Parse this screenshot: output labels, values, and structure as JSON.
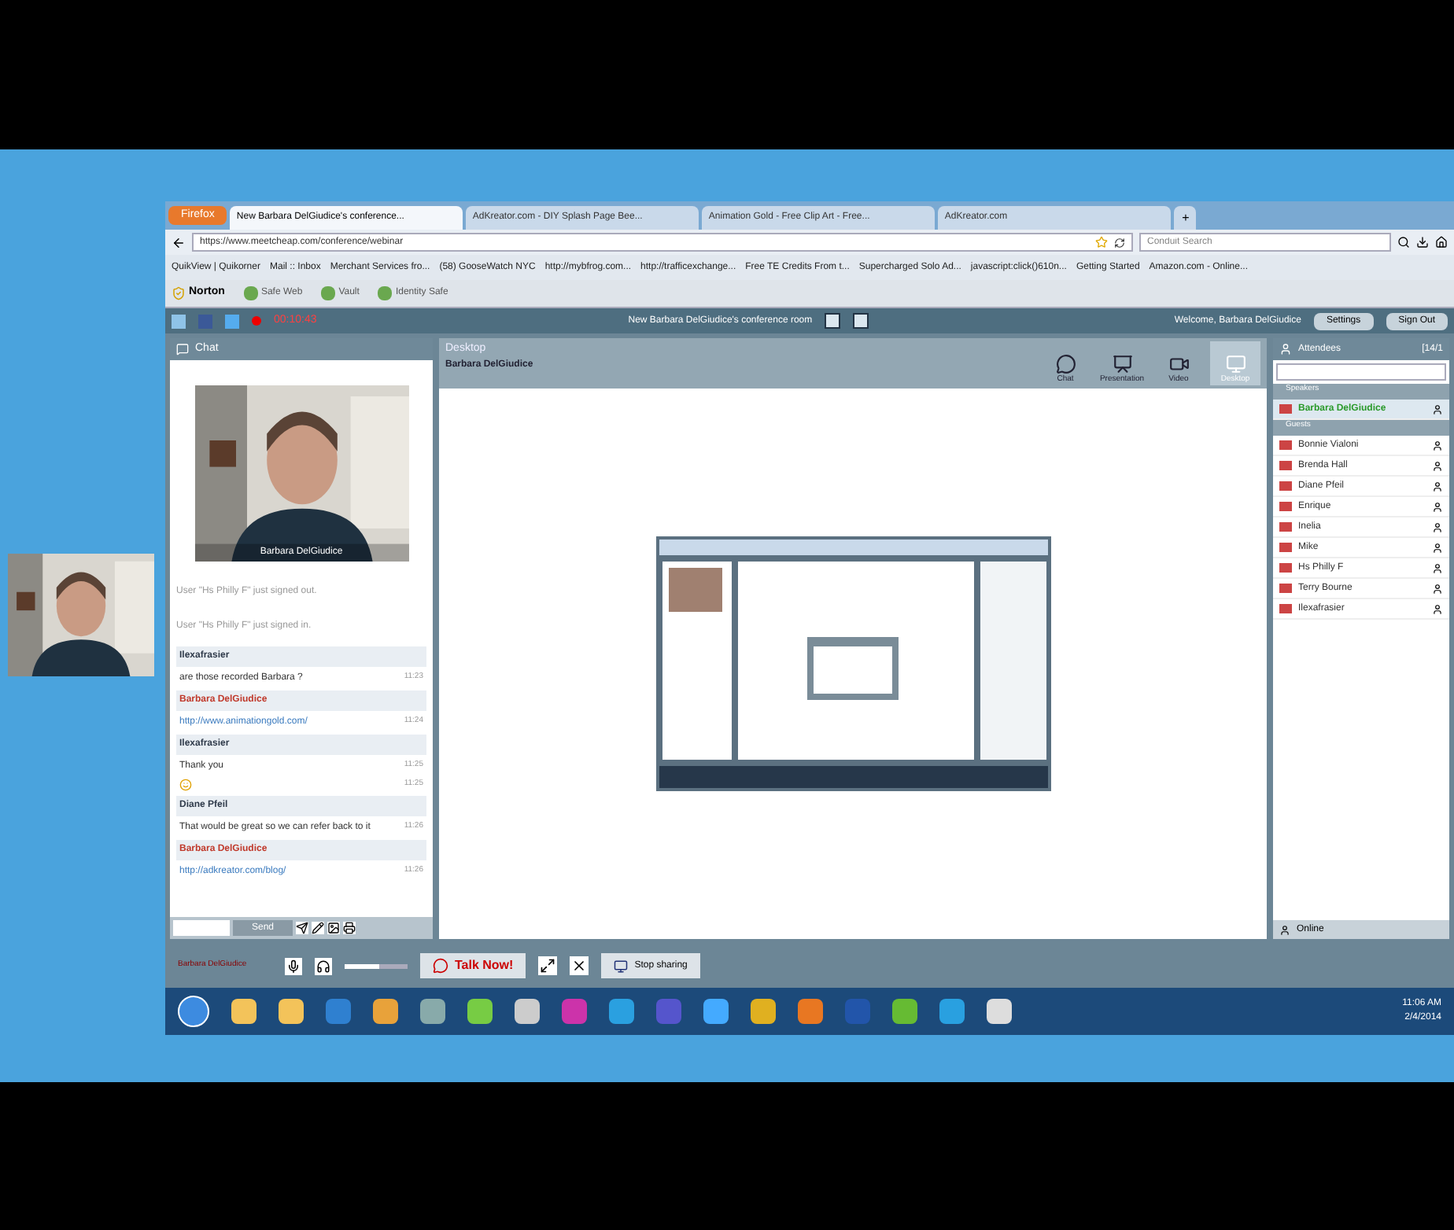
{
  "browser": {
    "menu_button": "Firefox",
    "tabs": [
      {
        "label": "New Barbara DelGiudice's conference...",
        "selected": true
      },
      {
        "label": "AdKreator.com - DIY Splash Page Bee...",
        "selected": false
      },
      {
        "label": "Animation Gold - Free Clip Art - Free...",
        "selected": false
      },
      {
        "label": "AdKreator.com",
        "selected": false
      }
    ],
    "new_tab": "+",
    "url": "https://www.meetcheap.com/conference/webinar",
    "search": {
      "placeholder": "Conduit Search"
    },
    "bookmarks": [
      "QuikView | Quikorner",
      "Mail :: Inbox",
      "Merchant Services fro...",
      "(58) GooseWatch NYC",
      "http://mybfrog.com...",
      "http://trafficexchange...",
      "Free TE Credits From t...",
      "Supercharged Solo Ad...",
      "javascript:click()610n...",
      "Getting Started",
      "Amazon.com - Online..."
    ],
    "norton": {
      "brand": "Norton",
      "items": [
        "Safe Web",
        "Vault",
        "Identity Safe"
      ]
    }
  },
  "conference": {
    "timer": "00:10:43",
    "room_title": "New Barbara DelGiudice's conference room",
    "welcome": "Welcome, Barbara DelGiudice",
    "buttons": [
      "Settings",
      "Sign Out"
    ],
    "chat": {
      "title": "Chat",
      "video_caption": "Barbara DelGiudice",
      "messages": [
        {
          "kind": "system",
          "text": "User \"Hs Philly F\" just signed out."
        },
        {
          "kind": "system",
          "text": "User \"Hs Philly F\" just signed in."
        },
        {
          "kind": "sender",
          "text": "Ilexafrasier",
          "color": "#2f3a4a"
        },
        {
          "kind": "text",
          "text": "are those recorded Barbara ?",
          "time": "11:23"
        },
        {
          "kind": "sender",
          "text": "Barbara DelGiudice",
          "color": "#c0392b"
        },
        {
          "kind": "link",
          "text": "http://www.animationgold.com/",
          "time": "11:24"
        },
        {
          "kind": "sender",
          "text": "Ilexafrasier",
          "color": "#2f3a4a"
        },
        {
          "kind": "text",
          "text": "Thank you",
          "time": "11:25"
        },
        {
          "kind": "emoji",
          "time": "11:25"
        },
        {
          "kind": "sender",
          "text": "Diane Pfeil",
          "color": "#2f3a4a"
        },
        {
          "kind": "text",
          "text": "That would be great so we can refer back to it",
          "time": "11:26"
        },
        {
          "kind": "sender",
          "text": "Barbara DelGiudice",
          "color": "#c0392b"
        },
        {
          "kind": "link",
          "text": "http://adkreator.com/blog/",
          "time": "11:26"
        }
      ],
      "send_button": "Send"
    },
    "desktop": {
      "title": "Desktop",
      "presenter": "Barbara DelGiudice",
      "modes": [
        {
          "label": "Chat",
          "selected": false
        },
        {
          "label": "Presentation",
          "selected": false
        },
        {
          "label": "Video",
          "selected": false
        },
        {
          "label": "Desktop",
          "selected": true
        }
      ]
    },
    "attendees": {
      "title": "Attendees",
      "count": "[14/1",
      "groups": [
        {
          "kind": "speakers",
          "name": "Speakers",
          "people": [
            "Barbara DelGiudice"
          ]
        },
        {
          "kind": "guests",
          "name": "Guests",
          "people": [
            "Bonnie Vialoni",
            "Brenda Hall",
            "Diane Pfeil",
            "Enrique",
            "Inelia",
            "Mike",
            "Hs Philly F",
            "Terry Bourne",
            "Ilexafrasier"
          ]
        }
      ],
      "status": "Online"
    },
    "controls": {
      "speaker": "Barbara DelGiudice",
      "volume": {
        "level": 0.55
      },
      "talk_button": "Talk Now!",
      "share_button": "Stop sharing"
    }
  },
  "taskbar": {
    "time": "11:06 AM",
    "date": "2/4/2014"
  }
}
